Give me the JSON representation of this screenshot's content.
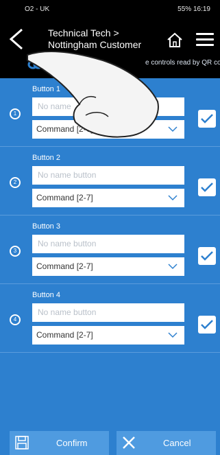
{
  "status": {
    "carrier": "O2 - UK",
    "right": "55%",
    "time": "16:19"
  },
  "header": {
    "title_line1": "Technical Tech >",
    "title_line2": "Nottingham Customer",
    "subtitle_left": "To",
    "subtitle_right": "e controls read by QR code"
  },
  "buttons": [
    {
      "label": "Button 1",
      "number": "1",
      "name_placeholder": "No name",
      "command": "Command [2-7]"
    },
    {
      "label": "Button 2",
      "number": "2",
      "name_placeholder": "No name button",
      "command": "Command [2-7]"
    },
    {
      "label": "Button 3",
      "number": "3",
      "name_placeholder": "No name button",
      "command": "Command [2-7]"
    },
    {
      "label": "Button 4",
      "number": "4",
      "name_placeholder": "No name button",
      "command": "Command [2-7]"
    }
  ],
  "footer": {
    "confirm_label": "Confirm",
    "cancel_label": "Cancel"
  },
  "colors": {
    "background": "#2d80cf",
    "header": "#000000",
    "footer_button": "#4f9be0"
  }
}
